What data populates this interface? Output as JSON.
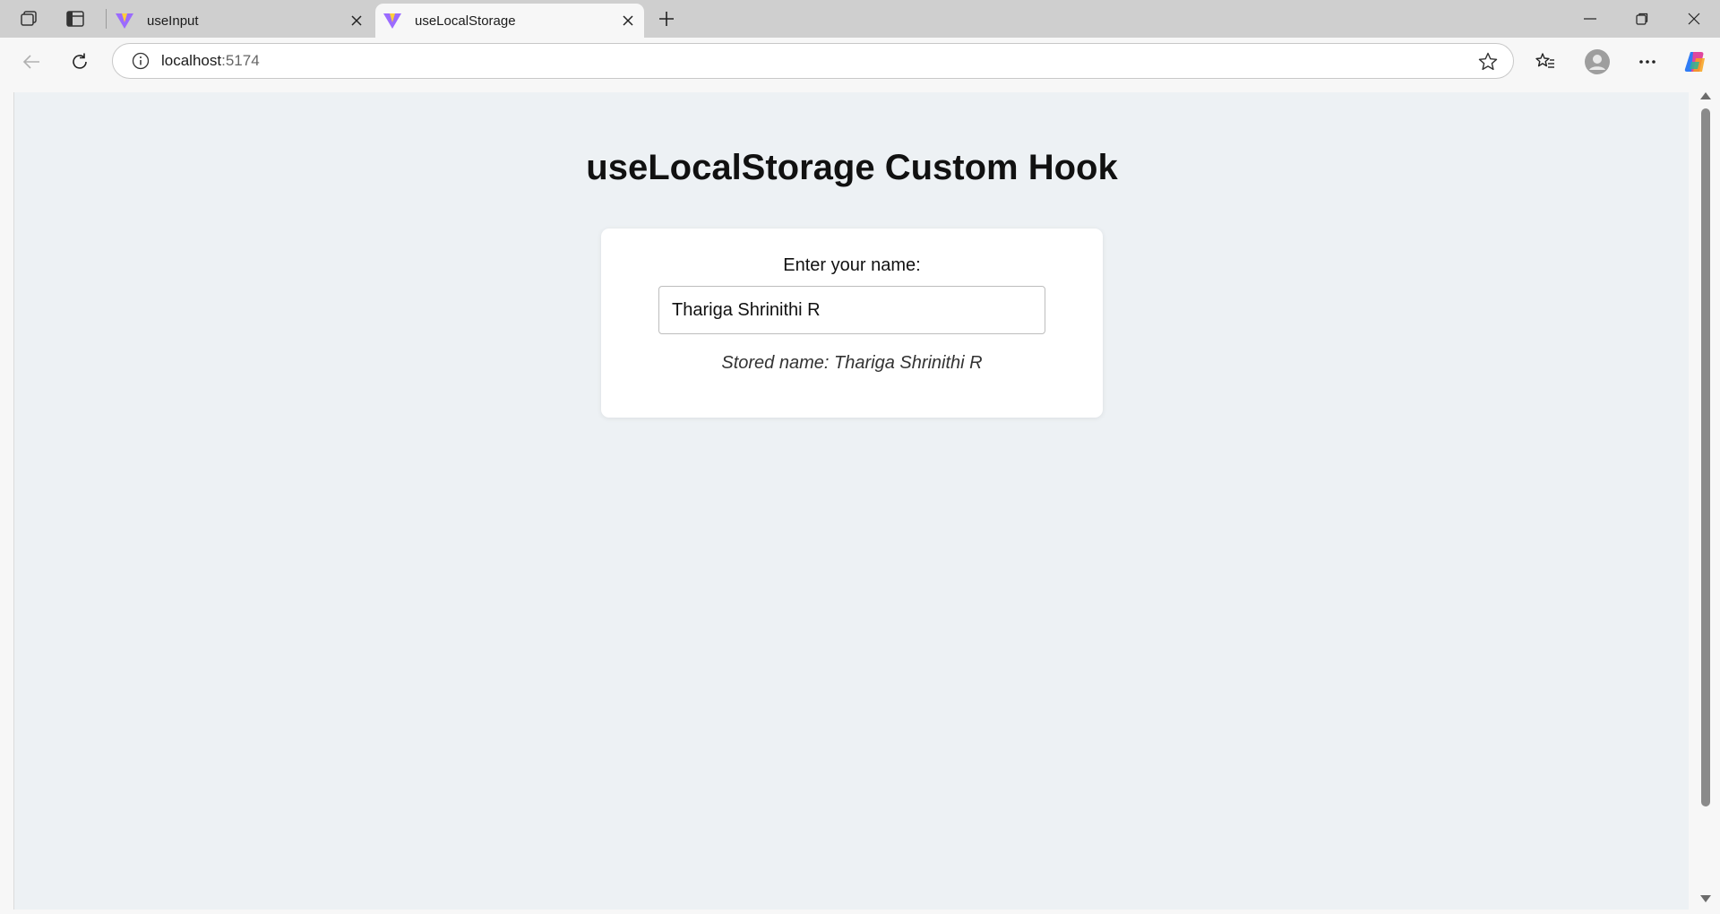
{
  "browser": {
    "tabs": [
      {
        "title": "useInput",
        "active": false
      },
      {
        "title": "useLocalStorage",
        "active": true
      }
    ],
    "address": {
      "host": "localhost",
      "port": ":5174"
    }
  },
  "page": {
    "title": "useLocalStorage Custom Hook",
    "label": "Enter your name:",
    "input_value": "Thariga Shrinithi R",
    "stored_text": "Stored name: Thariga Shrinithi R"
  },
  "colors": {
    "page_background": "#edf1f4",
    "card_background": "#ffffff",
    "tabbar": "#cfcfcf"
  },
  "icons": [
    "workspaces-icon",
    "tab-actions-icon",
    "vite-favicon-icon",
    "close-icon",
    "plus-icon",
    "minimize-icon",
    "restore-icon",
    "window-close-icon",
    "back-icon",
    "refresh-icon",
    "info-icon",
    "star-icon",
    "favorites-icon",
    "profile-icon",
    "more-icon",
    "copilot-icon"
  ]
}
